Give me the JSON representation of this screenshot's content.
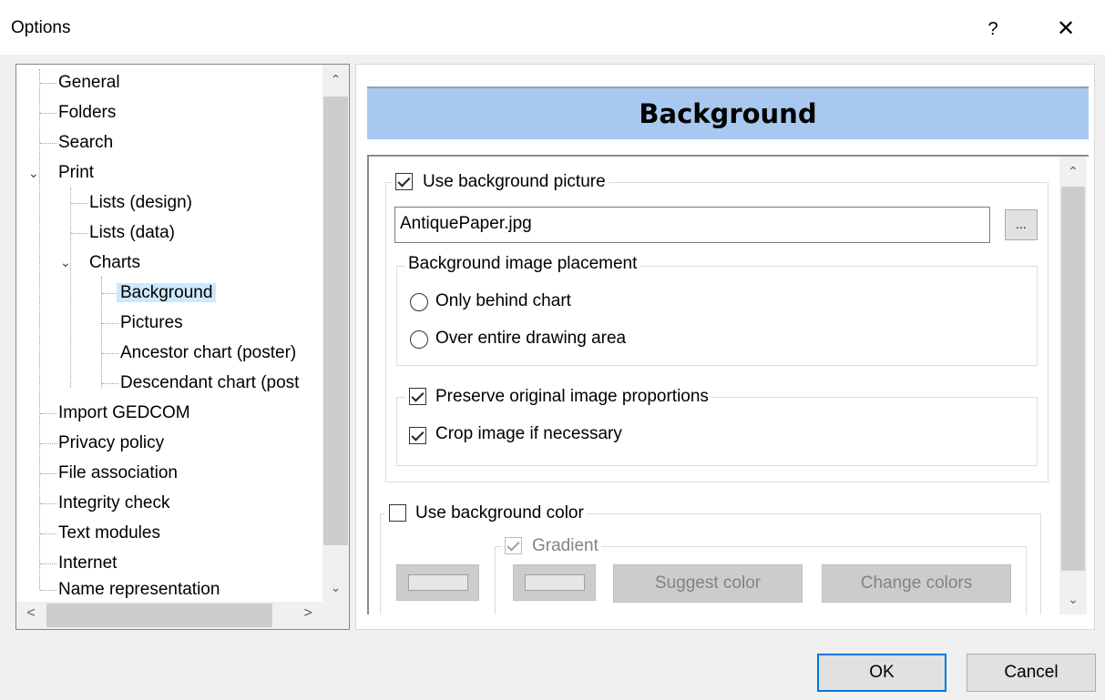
{
  "window": {
    "title": "Options",
    "help_label": "?",
    "close_label": "✕"
  },
  "tree": {
    "items": [
      {
        "label": "General"
      },
      {
        "label": "Folders"
      },
      {
        "label": "Search"
      },
      {
        "label": "Print"
      },
      {
        "label": "Lists (design)"
      },
      {
        "label": "Lists (data)"
      },
      {
        "label": "Charts"
      },
      {
        "label": "Background"
      },
      {
        "label": "Pictures"
      },
      {
        "label": "Ancestor chart (poster)"
      },
      {
        "label": "Descendant chart (post"
      },
      {
        "label": "Import GEDCOM"
      },
      {
        "label": "Privacy policy"
      },
      {
        "label": "File association"
      },
      {
        "label": "Integrity check"
      },
      {
        "label": "Text modules"
      },
      {
        "label": "Internet"
      },
      {
        "label": "Name representation"
      }
    ],
    "selected": "Background"
  },
  "panel": {
    "header": "Background",
    "use_picture_label": "Use background picture",
    "use_picture_checked": true,
    "picture_file": "AntiquePaper.jpg",
    "browse_label": "...",
    "placement_group_label": "Background image placement",
    "placement_options": [
      "Only behind chart",
      "Over entire drawing area"
    ],
    "preserve_label": "Preserve original image proportions",
    "preserve_checked": true,
    "crop_label": "Crop image if necessary",
    "crop_checked": true,
    "use_color_label": "Use background color",
    "use_color_checked": false,
    "gradient_label": "Gradient",
    "gradient_checked": true,
    "suggest_label": "Suggest color",
    "change_label": "Change colors"
  },
  "footer": {
    "ok_label": "OK",
    "cancel_label": "Cancel"
  }
}
